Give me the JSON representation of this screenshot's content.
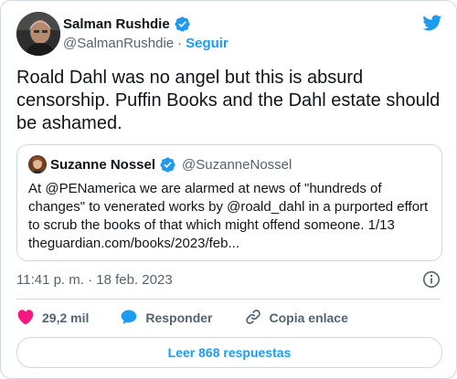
{
  "author": {
    "name": "Salman Rushdie",
    "handle": "@SalmanRushdie",
    "separator": "·",
    "follow_label": "Seguir"
  },
  "tweet": {
    "text": "Roald Dahl was no angel but this is absurd censorship. Puffin Books and the Dahl estate should be ashamed."
  },
  "quoted": {
    "name": "Suzanne Nossel",
    "handle": "@SuzanneNossel",
    "text": "At @PENamerica we are alarmed at news of \"hundreds of changes\" to venerated works by @roald_dahl in a purported effort to scrub the books of that which might offend someone. 1/13 theguardian.com/books/2023/feb..."
  },
  "meta": {
    "timestamp": "11:41 p. m. · 18 feb. 2023"
  },
  "actions": {
    "likes": "29,2 mil",
    "reply": "Responder",
    "copy_link": "Copia enlace"
  },
  "read_replies": "Leer 868 respuestas",
  "colors": {
    "accent": "#1d9bf0",
    "like": "#f91880",
    "muted": "#536471"
  }
}
